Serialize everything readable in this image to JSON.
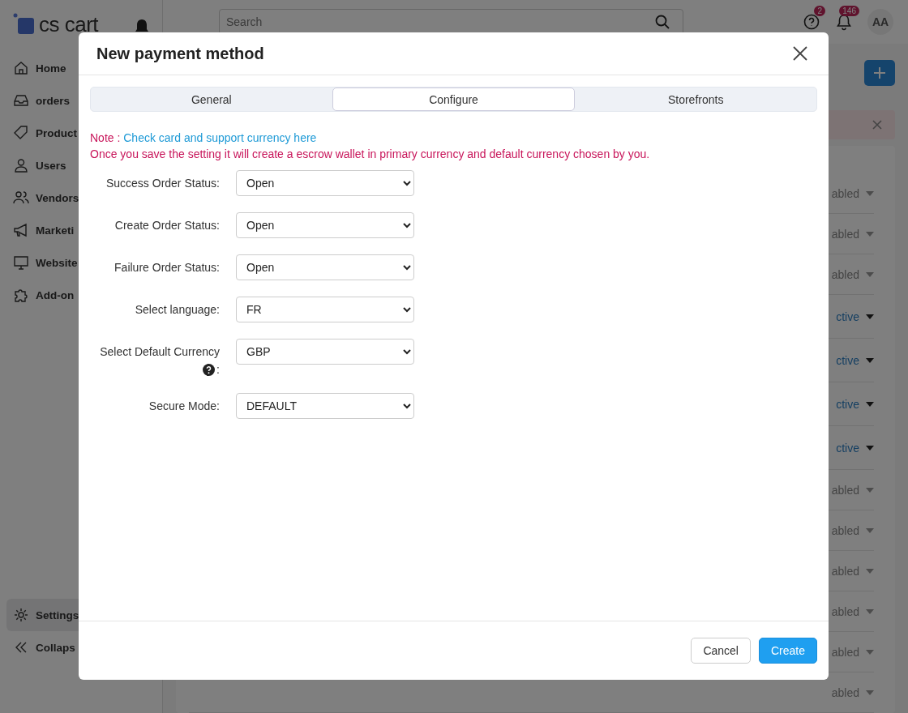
{
  "brand": {
    "name": "cs cart"
  },
  "sidebar": {
    "items": [
      {
        "label": "Home",
        "selected": false
      },
      {
        "label": "orders",
        "selected": false
      },
      {
        "label": "Product",
        "selected": false
      },
      {
        "label": "Users",
        "selected": false
      },
      {
        "label": "Vendors",
        "selected": false
      },
      {
        "label": "Marketi",
        "selected": false
      },
      {
        "label": "Website",
        "selected": false
      },
      {
        "label": "Add-on",
        "selected": false
      }
    ],
    "bottom_items": [
      {
        "label": "Settings",
        "selected": true
      },
      {
        "label": "Collaps",
        "selected": false
      }
    ]
  },
  "topbar": {
    "search": {
      "placeholder": "Search"
    },
    "help_badge": "2",
    "notifications_badge": "146",
    "avatar": "AA"
  },
  "list": {
    "rows": [
      {
        "status": "abled",
        "active": false
      },
      {
        "status": "abled",
        "active": false
      },
      {
        "status": "abled",
        "active": false
      },
      {
        "status": "ctive",
        "active": true
      },
      {
        "status": "ctive",
        "active": true
      },
      {
        "status": "ctive",
        "active": true
      },
      {
        "status": "ctive",
        "active": true
      },
      {
        "status": "abled",
        "active": false
      },
      {
        "status": "abled",
        "active": false
      },
      {
        "status": "abled",
        "active": false
      },
      {
        "status": "abled",
        "active": false
      },
      {
        "status": "abled",
        "active": false
      },
      {
        "status": "abled",
        "active": false
      }
    ]
  },
  "dialog": {
    "title": "New payment method",
    "tabs": [
      {
        "label": "General",
        "selected": false
      },
      {
        "label": "Configure",
        "selected": true
      },
      {
        "label": "Storefronts",
        "selected": false
      }
    ],
    "note": {
      "prefix": "Note : ",
      "link": "Check card and support currency here",
      "text": "Once you save the setting it will create a escrow wallet in primary currency and default currency chosen by you."
    },
    "fields": [
      {
        "label": "Success Order Status:",
        "value": "Open",
        "help": false
      },
      {
        "label": "Create Order Status:",
        "value": "Open",
        "help": false
      },
      {
        "label": "Failure Order Status:",
        "value": "Open",
        "help": false
      },
      {
        "label": "Select language:",
        "value": "FR",
        "help": false
      },
      {
        "label": "Select Default Currency",
        "value": "GBP",
        "help": true,
        "suffix": ":"
      },
      {
        "label": "Secure Mode:",
        "value": "DEFAULT",
        "help": false
      }
    ],
    "buttons": [
      {
        "label": "Cancel",
        "kind": "secondary"
      },
      {
        "label": "Create",
        "kind": "primary"
      }
    ]
  }
}
